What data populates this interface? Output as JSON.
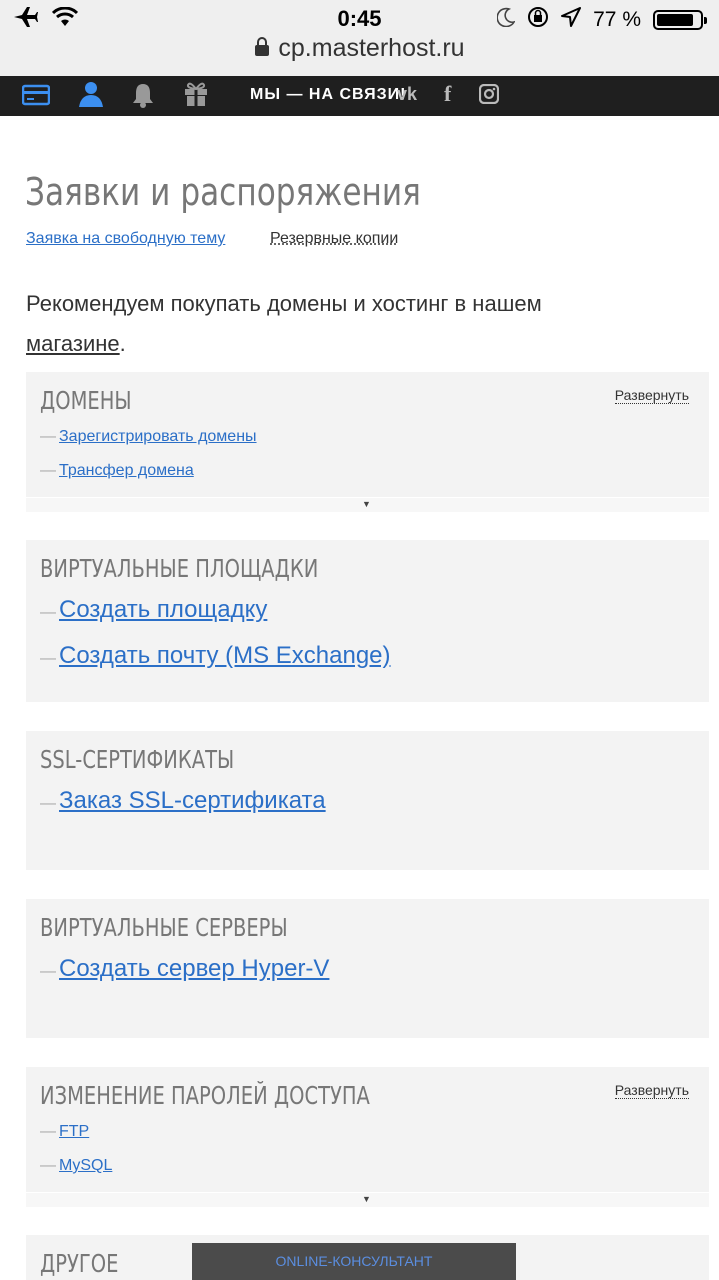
{
  "status_bar": {
    "time": "0:45",
    "battery_text": "77 %",
    "url": "cp.masterhost.ru",
    "icons": [
      "airplane-icon",
      "wifi-icon",
      "moon-icon",
      "orientation-lock-icon",
      "location-icon",
      "battery-icon",
      "lock-icon"
    ]
  },
  "topnav": {
    "slogan": "МЫ — НА СВЯЗИ!",
    "vk": "vk",
    "fb": "f",
    "icons": [
      "card-icon",
      "user-icon",
      "bell-icon",
      "gift-icon",
      "vk-icon",
      "facebook-icon",
      "instagram-icon"
    ]
  },
  "page": {
    "title": "Заявки и распоряжения",
    "link_free_topic": "Заявка на свободную тему",
    "link_backups": "Резервные копии",
    "recommend_text": "Рекомендуем покупать домены и хостинг в нашем",
    "recommend_link": "магазине",
    "recommend_end": "."
  },
  "cards": {
    "domains": {
      "title": "ДОМЕНЫ",
      "expand": "Развернуть",
      "items": [
        "Зарегистрировать домены",
        "Трансфер домена"
      ]
    },
    "virtual_sites": {
      "title": "ВИРТУАЛЬНЫЕ ПЛОЩАДКИ",
      "items": [
        "Создать площадку",
        "Создать почту (MS Exchange)"
      ]
    },
    "ssl": {
      "title": "SSL-СЕРТИФИКАТЫ",
      "items": [
        "Заказ SSL-сертификата"
      ]
    },
    "virtual_servers": {
      "title": "ВИРТУАЛЬНЫЕ СЕРВЕРЫ",
      "items": [
        "Создать сервер Hyper-V"
      ]
    },
    "passwords": {
      "title": "ИЗМЕНЕНИЕ ПАРОЛЕЙ ДОСТУПА",
      "expand": "Развернуть",
      "items": [
        "FTP",
        "MySQL"
      ]
    },
    "other": {
      "title": "ДРУГОЕ"
    }
  },
  "online_consultant": "ONLINE-КОНСУЛЬТАНТ",
  "colors": {
    "link": "#2b6fc7",
    "nav_bg": "#1f1f1f",
    "card_bg": "#f3f3f3",
    "title_gray": "#777777"
  }
}
